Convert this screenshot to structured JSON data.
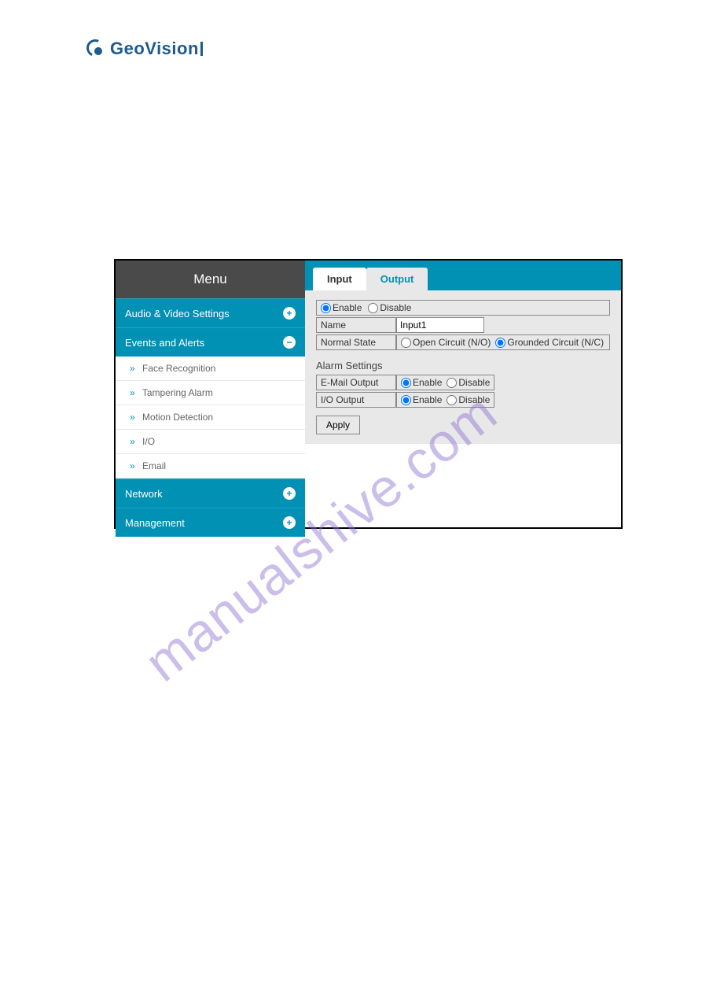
{
  "logo": {
    "text": "GeoVision"
  },
  "watermark": "manualshive.com",
  "sidebar": {
    "title": "Menu",
    "sections": [
      {
        "label": "Audio & Video Settings",
        "expanded": false
      },
      {
        "label": "Events and Alerts",
        "expanded": true
      },
      {
        "label": "Network",
        "expanded": false
      },
      {
        "label": "Management",
        "expanded": false
      }
    ],
    "subitems": [
      {
        "label": "Face Recognition"
      },
      {
        "label": "Tampering Alarm"
      },
      {
        "label": "Motion Detection"
      },
      {
        "label": "I/O"
      },
      {
        "label": "Email"
      }
    ]
  },
  "tabs": {
    "input": "Input",
    "output": "Output"
  },
  "form": {
    "enable_label": "Enable",
    "disable_label": "Disable",
    "name_label": "Name",
    "name_value": "Input1",
    "normal_state_label": "Normal State",
    "no_label": "Open Circuit (N/O)",
    "nc_label": "Grounded Circuit (N/C)",
    "alarm_title": "Alarm Settings",
    "email_output_label": "E-Mail Output",
    "io_output_label": "I/O Output",
    "apply": "Apply"
  }
}
